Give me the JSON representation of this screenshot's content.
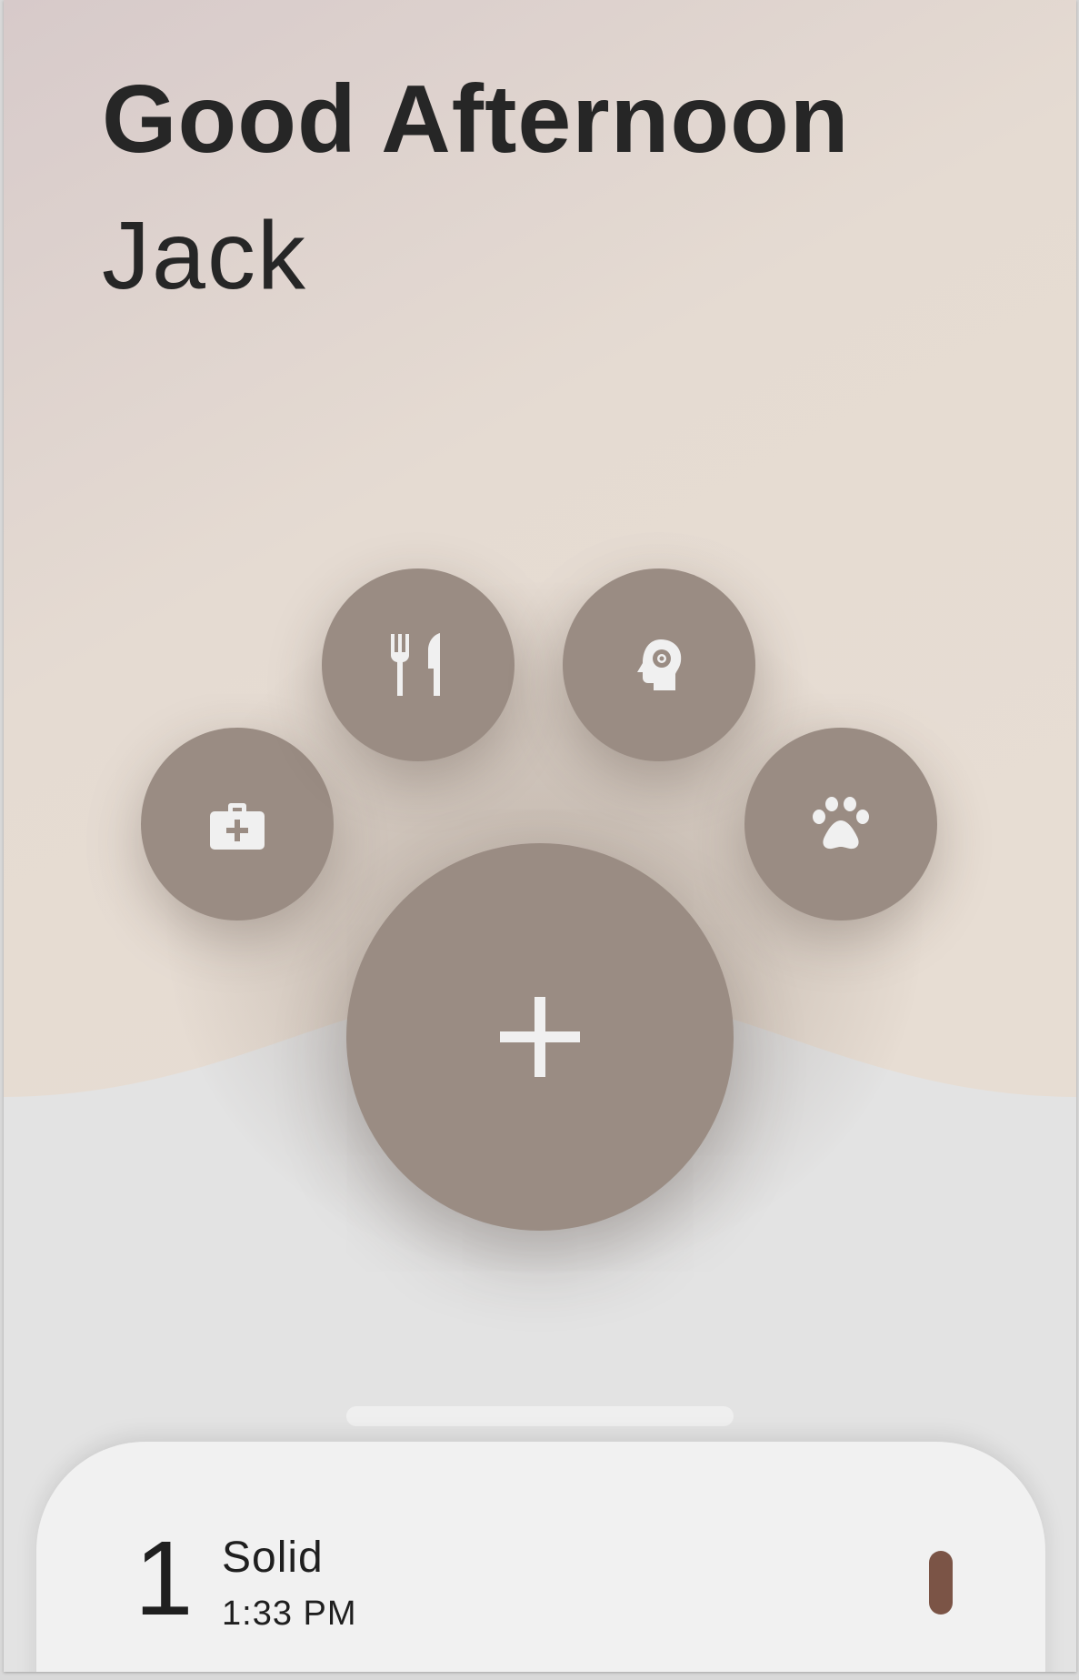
{
  "greeting": {
    "title": "Good Afternoon",
    "name": "Jack"
  },
  "category_buttons": [
    {
      "id": "medical",
      "icon": "medical-kit-icon"
    },
    {
      "id": "food",
      "icon": "fork-knife-icon"
    },
    {
      "id": "mind",
      "icon": "head-gear-icon"
    },
    {
      "id": "pet",
      "icon": "paw-icon"
    }
  ],
  "add_button": {
    "icon": "plus-icon"
  },
  "entry": {
    "count": "1",
    "type": "Solid",
    "time": "1:33 PM",
    "indicator_color": "#7b5446"
  },
  "colors": {
    "button": "#9a8c83",
    "icon": "#f0f0f0",
    "header_top": "#d8cbcb",
    "header_bottom": "#e6ddd3",
    "body": "#e3e3e3",
    "sheet": "#f1f1f1"
  }
}
